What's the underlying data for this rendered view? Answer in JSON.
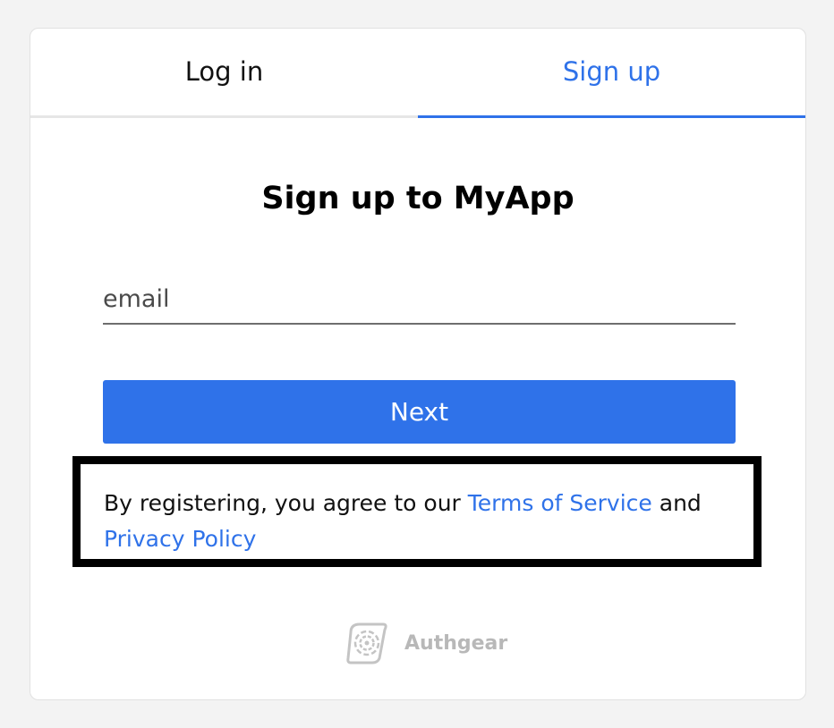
{
  "tabs": {
    "login_label": "Log in",
    "signup_label": "Sign up"
  },
  "form": {
    "title": "Sign up to MyApp",
    "email_placeholder": "email",
    "email_value": "",
    "next_label": "Next"
  },
  "terms": {
    "prefix": "By registering, you agree to our ",
    "tos_label": "Terms of Service",
    "middle": " and ",
    "privacy_label": "Privacy Policy"
  },
  "brand": {
    "name": "Authgear",
    "logo_icon": "authgear-logo-icon"
  },
  "colors": {
    "accent": "#2f72e9",
    "background": "#f3f3f3"
  }
}
